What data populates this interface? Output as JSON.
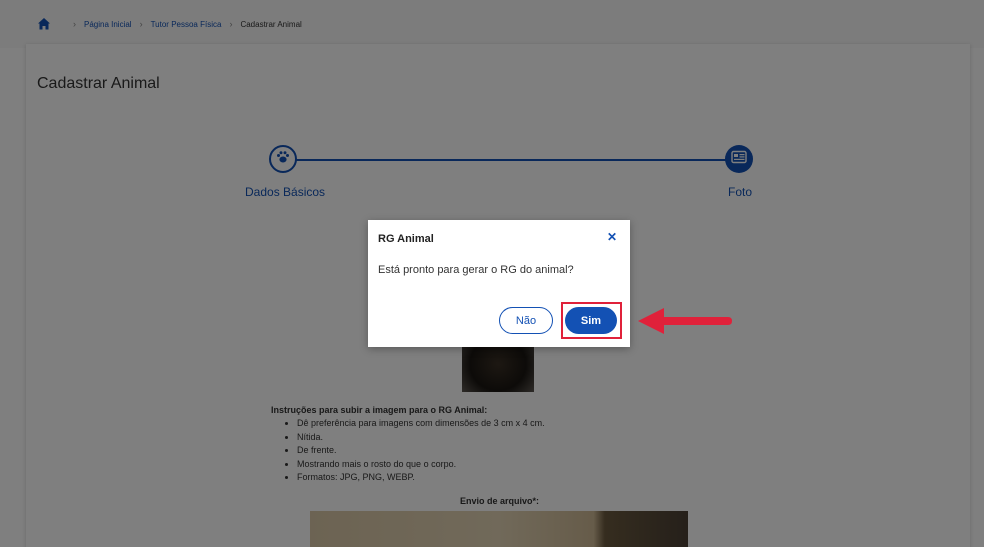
{
  "breadcrumb": {
    "home_icon": "home-icon",
    "items": [
      "Página Inicial",
      "Tutor Pessoa Física",
      "Cadastrar Animal"
    ]
  },
  "page": {
    "title": "Cadastrar Animal"
  },
  "stepper": {
    "steps": [
      {
        "label": "Dados Básicos",
        "icon": "paw-icon"
      },
      {
        "label": "Foto",
        "icon": "id-card-icon"
      }
    ],
    "accent": "#1351b4"
  },
  "instructions": {
    "title": "Instruções para subir a imagem para o RG Animal:",
    "items": [
      "Dê preferência para imagens com dimensões de 3 cm x 4 cm.",
      "Nítida.",
      "De frente.",
      "Mostrando mais o rosto do que o corpo.",
      "Formatos: JPG, PNG, WEBP."
    ],
    "upload_label": "Envio de arquivo*:"
  },
  "modal": {
    "title": "RG Animal",
    "close_icon": "close-icon",
    "body": "Está pronto para gerar o RG do animal?",
    "no_label": "Não",
    "yes_label": "Sim"
  },
  "annotation": {
    "highlight_color": "#e0213a"
  }
}
